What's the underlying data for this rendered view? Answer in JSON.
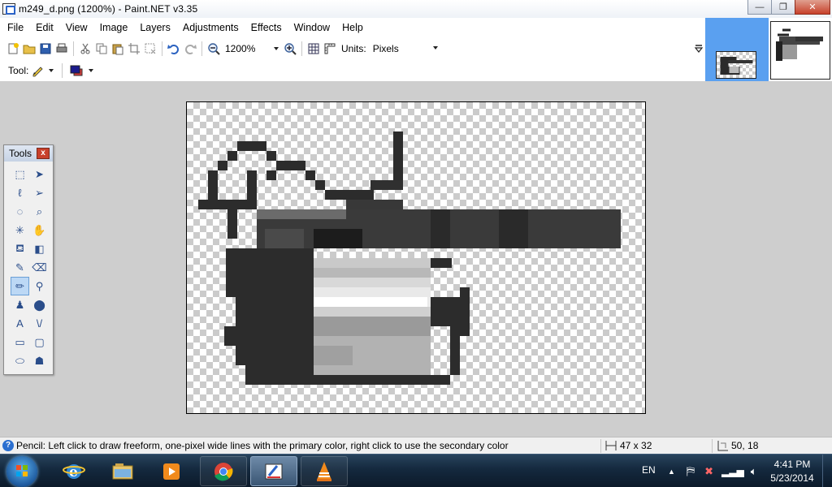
{
  "window": {
    "title": "m249_d.png (1200%) - Paint.NET v3.35",
    "min_glyph": "—",
    "max_glyph": "❐",
    "close_glyph": "✕"
  },
  "menubar": {
    "items": [
      "File",
      "Edit",
      "View",
      "Image",
      "Layers",
      "Adjustments",
      "Effects",
      "Window",
      "Help"
    ]
  },
  "toolbar": {
    "zoom_value": "1200%",
    "units_label": "Units:",
    "units_value": "Pixels",
    "tool_label": "Tool:"
  },
  "tools_window": {
    "title": "Tools",
    "close_glyph": "x",
    "tools": [
      {
        "name": "rectangle-select-icon",
        "glyph": "⬚",
        "selected": false
      },
      {
        "name": "move-selected-pixels-icon",
        "glyph": "➤",
        "selected": false
      },
      {
        "name": "lasso-select-icon",
        "glyph": "ℓ",
        "selected": false
      },
      {
        "name": "move-selection-icon",
        "glyph": "➢",
        "selected": false
      },
      {
        "name": "ellipse-select-icon",
        "glyph": "◌",
        "selected": false
      },
      {
        "name": "zoom-icon",
        "glyph": "⌕",
        "selected": false
      },
      {
        "name": "magic-wand-icon",
        "glyph": "✳",
        "selected": false
      },
      {
        "name": "pan-icon",
        "glyph": "✋",
        "selected": false
      },
      {
        "name": "paint-bucket-icon",
        "glyph": "⛾",
        "selected": false
      },
      {
        "name": "gradient-icon",
        "glyph": "◧",
        "selected": false
      },
      {
        "name": "paintbrush-icon",
        "glyph": "✎",
        "selected": false
      },
      {
        "name": "eraser-icon",
        "glyph": "⌫",
        "selected": false
      },
      {
        "name": "pencil-icon",
        "glyph": "✏",
        "selected": true
      },
      {
        "name": "color-picker-icon",
        "glyph": "⚲",
        "selected": false
      },
      {
        "name": "clone-stamp-icon",
        "glyph": "♟",
        "selected": false
      },
      {
        "name": "recolor-icon",
        "glyph": "⬤",
        "selected": false
      },
      {
        "name": "text-icon",
        "glyph": "A",
        "selected": false
      },
      {
        "name": "line-curve-icon",
        "glyph": "\\/",
        "selected": false
      },
      {
        "name": "rectangle-icon",
        "glyph": "▭",
        "selected": false
      },
      {
        "name": "rounded-rectangle-icon",
        "glyph": "▢",
        "selected": false
      },
      {
        "name": "ellipse-icon",
        "glyph": "⬭",
        "selected": false
      },
      {
        "name": "freeform-shape-icon",
        "glyph": "☗",
        "selected": false
      }
    ]
  },
  "status": {
    "hint": "Pencil: Left click to draw freeform, one-pixel wide lines with the primary color, right click to use the secondary color",
    "image_size": "47 x 32",
    "cursor_position": "50, 18"
  },
  "taskbar": {
    "language": "EN",
    "time": "4:41 PM",
    "date": "5/23/2014"
  },
  "colors": {
    "primary": "#1b1b8c",
    "secondary": "#d23b3b",
    "selection_blue": "#5aa0f0"
  }
}
